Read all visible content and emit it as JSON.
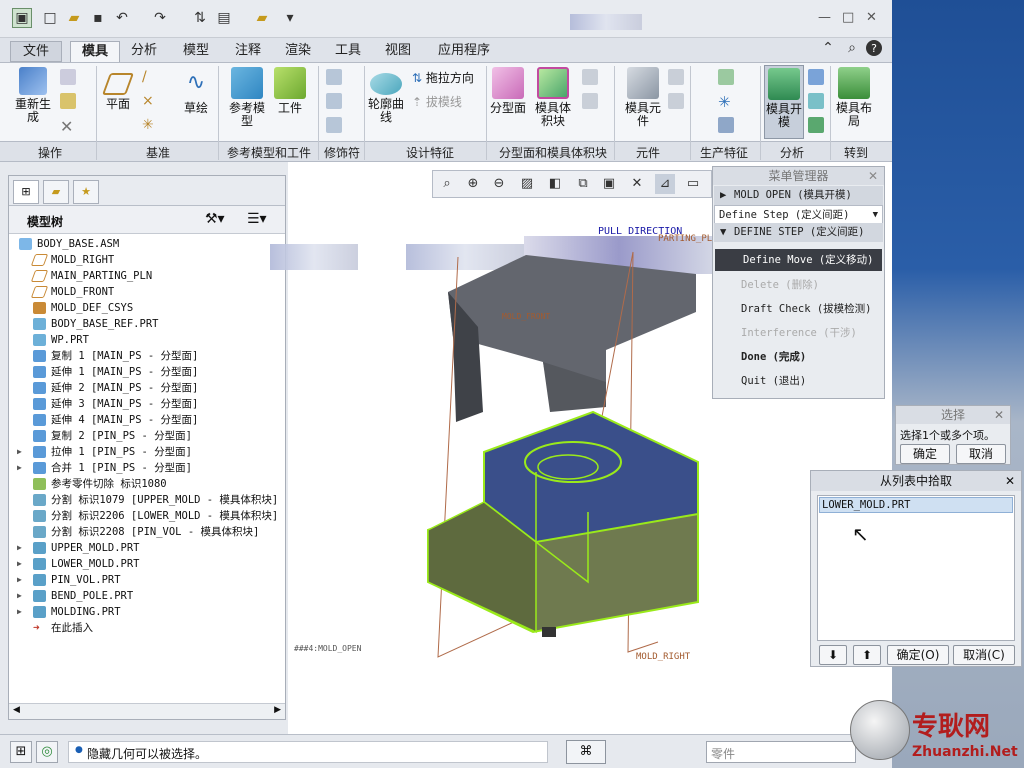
{
  "ribbon_tabs": [
    "文件",
    "模具",
    "分析",
    "模型",
    "注释",
    "渲染",
    "工具",
    "视图",
    "应用程序"
  ],
  "ribbon": {
    "regenerate": "重新生成",
    "plane": "平面",
    "sketch": "草绘",
    "ref_model": "参考模型",
    "workpiece": "工件",
    "drag_dir": "拖拉方向",
    "draft_line": "拔模线",
    "profile_curve": "轮廓曲线",
    "parting_surface": "分型面",
    "mold_volume": "模具体积块",
    "mold_component": "模具元件",
    "mold_open": "模具开模",
    "mold_layout": "模具布局"
  },
  "groups": [
    "操作",
    "基准",
    "参考模型和工件",
    "修饰符",
    "设计特征",
    "分型面和模具体积块",
    "元件",
    "生产特征",
    "分析",
    "转到"
  ],
  "model_tree": {
    "title": "模型树",
    "items": [
      {
        "label": "BODY_BASE.ASM"
      },
      {
        "label": "MOLD_RIGHT"
      },
      {
        "label": "MAIN_PARTING_PLN"
      },
      {
        "label": "MOLD_FRONT"
      },
      {
        "label": "MOLD_DEF_CSYS"
      },
      {
        "label": "BODY_BASE_REF.PRT"
      },
      {
        "label": "WP.PRT"
      },
      {
        "label": "复制 1 [MAIN_PS - 分型面]"
      },
      {
        "label": "延伸 1 [MAIN_PS - 分型面]"
      },
      {
        "label": "延伸 2 [MAIN_PS - 分型面]"
      },
      {
        "label": "延伸 3 [MAIN_PS - 分型面]"
      },
      {
        "label": "延伸 4 [MAIN_PS - 分型面]"
      },
      {
        "label": "复制 2 [PIN_PS - 分型面]"
      },
      {
        "label": "拉伸 1 [PIN_PS - 分型面]"
      },
      {
        "label": "合并 1 [PIN_PS - 分型面]"
      },
      {
        "label": "参考零件切除 标识1080"
      },
      {
        "label": "分割 标识1079 [UPPER_MOLD - 模具体积块]"
      },
      {
        "label": "分割 标识2206 [LOWER_MOLD - 模具体积块]"
      },
      {
        "label": "分割 标识2208 [PIN_VOL - 模具体积块]"
      },
      {
        "label": "UPPER_MOLD.PRT"
      },
      {
        "label": "LOWER_MOLD.PRT"
      },
      {
        "label": "PIN_VOL.PRT"
      },
      {
        "label": "BEND_POLE.PRT"
      },
      {
        "label": "MOLDING.PRT"
      },
      {
        "label": "在此插入"
      }
    ]
  },
  "viewport": {
    "pull_direction": "PULL DIRECTION",
    "parting_pln": "PARTING_PLN",
    "mold_front": "MOLD_FRONT",
    "mold_right": "MOLD_RIGHT",
    "mold_open": "###4:MOLD_OPEN"
  },
  "menu_manager": {
    "title": "菜单管理器",
    "mold_open": "MOLD OPEN (模具开模)",
    "define_step_dropdown": "Define Step (定义间距)",
    "define_step_header": "DEFINE STEP (定义间距)",
    "items": {
      "define_move": "Define Move (定义移动)",
      "delete": "Delete (删除)",
      "draft_check": "Draft Check (拔模检测)",
      "interference": "Interference (干涉)",
      "done": "Done (完成)",
      "quit": "Quit (退出)"
    }
  },
  "select_dialog": {
    "title": "选择",
    "prompt": "选择1个或多个项。",
    "ok": "确定",
    "cancel": "取消"
  },
  "pick_dialog": {
    "title": "从列表中拾取",
    "item": "LOWER_MOLD.PRT",
    "ok": "确定(O)",
    "cancel": "取消(C)"
  },
  "status": {
    "message": "隐藏几何可以被选择。",
    "filter": "零件"
  },
  "watermark": {
    "cn": "专耿网",
    "url": "Zhuanzhi.Net"
  }
}
